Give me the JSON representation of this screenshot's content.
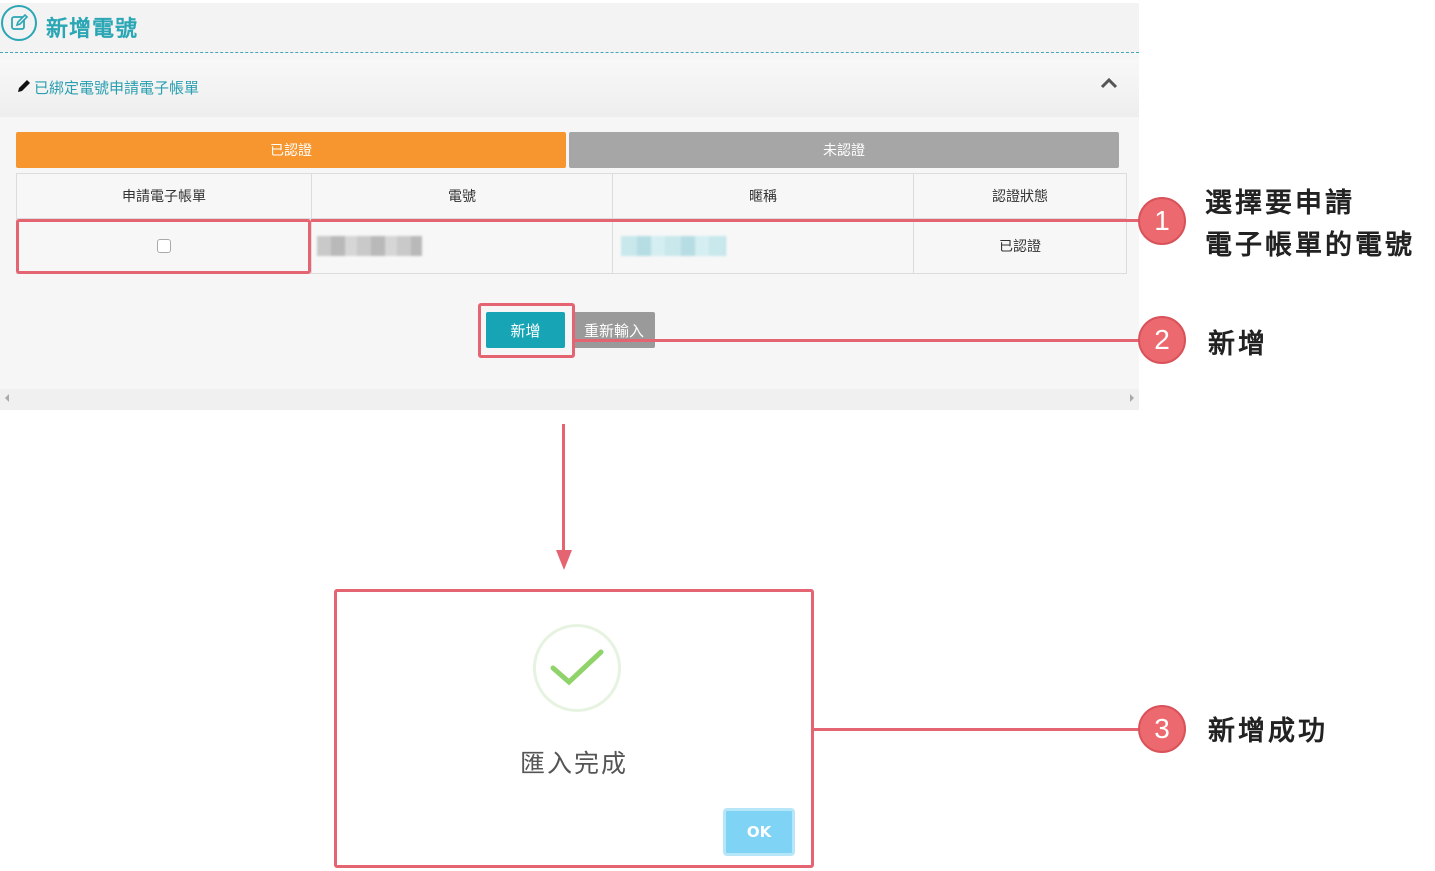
{
  "header": {
    "title": "新增電號",
    "icon": "edit-icon"
  },
  "section": {
    "title": "已綁定電號申請電子帳單",
    "icon": "pencil-icon",
    "collapse_icon": "chevron-up-icon"
  },
  "tabs": [
    {
      "label": "已認證",
      "active": true,
      "color": "#f7962e"
    },
    {
      "label": "未認證",
      "active": false,
      "color": "#a6a6a6"
    }
  ],
  "table": {
    "headers": [
      "申請電子帳單",
      "電號",
      "暱稱",
      "認證狀態"
    ],
    "rows": [
      {
        "apply": false,
        "status": "已認證"
      }
    ]
  },
  "buttons": {
    "add": "新增",
    "reset": "重新輸入"
  },
  "annotations": [
    {
      "number": "1",
      "lines": [
        "選擇要申請",
        "電子帳單的電號"
      ]
    },
    {
      "number": "2",
      "lines": [
        "新增"
      ]
    },
    {
      "number": "3",
      "lines": [
        "新增成功"
      ]
    }
  ],
  "modal": {
    "message": "匯入完成",
    "ok_label": "OK",
    "icon": "success-check-icon"
  },
  "colors": {
    "accent": "#2aa6b5",
    "highlight": "#e56472",
    "primary_button": "#17a5b5"
  }
}
